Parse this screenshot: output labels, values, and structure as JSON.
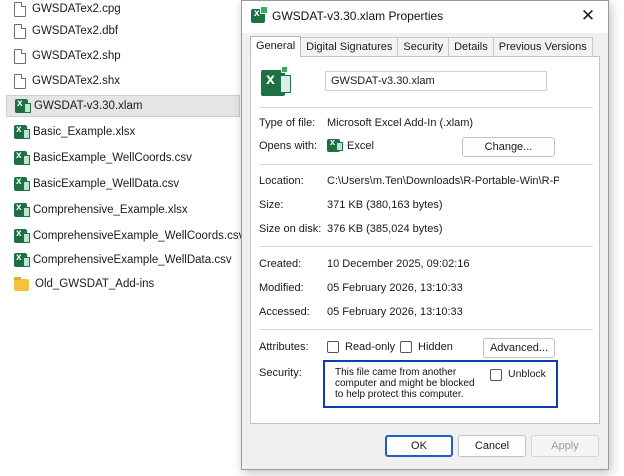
{
  "explorer": {
    "files": [
      {
        "name": "GWSDATex2.cpg",
        "icon": "document-icon",
        "selected": false
      },
      {
        "name": "GWSDATex2.dbf",
        "icon": "document-icon",
        "selected": false
      },
      {
        "name": "GWSDATex2.shp",
        "icon": "document-icon",
        "selected": false
      },
      {
        "name": "GWSDATex2.shx",
        "icon": "document-icon",
        "selected": false
      },
      {
        "name": "GWSDAT-v3.30.xlam",
        "icon": "excel-addin-icon",
        "selected": true
      },
      {
        "name": "Basic_Example.xlsx",
        "icon": "excel-file-icon",
        "selected": false
      },
      {
        "name": "BasicExample_WellCoords.csv",
        "icon": "excel-file-icon",
        "selected": false
      },
      {
        "name": "BasicExample_WellData.csv",
        "icon": "excel-file-icon",
        "selected": false
      },
      {
        "name": "Comprehensive_Example.xlsx",
        "icon": "excel-file-icon",
        "selected": false
      },
      {
        "name": "ComprehensiveExample_WellCoords.csv",
        "icon": "excel-file-icon",
        "selected": false
      },
      {
        "name": "ComprehensiveExample_WellData.csv",
        "icon": "excel-file-icon",
        "selected": false
      },
      {
        "name": "Old_GWSDAT_Add-ins",
        "icon": "folder-icon",
        "selected": false
      }
    ]
  },
  "dialog": {
    "title": "GWSDAT-v3.30.xlam Properties",
    "close_glyph": "✕",
    "tabs": [
      {
        "label": "General",
        "active": true
      },
      {
        "label": "Digital Signatures",
        "active": false
      },
      {
        "label": "Security",
        "active": false
      },
      {
        "label": "Details",
        "active": false
      },
      {
        "label": "Previous Versions",
        "active": false
      }
    ],
    "file_name": "GWSDAT-v3.30.xlam",
    "type_label": "Type of file:",
    "type_value": "Microsoft Excel Add-In (.xlam)",
    "opens_label": "Opens with:",
    "opens_value": "Excel",
    "change_button": "Change...",
    "location_label": "Location:",
    "location_value": "C:\\Users\\m.Ten\\Downloads\\R-Portable-Win\\R-Port",
    "size_label": "Size:",
    "size_value": "371 KB (380,163 bytes)",
    "size_disk_label": "Size on disk:",
    "size_disk_value": "376 KB (385,024 bytes)",
    "created_label": "Created:",
    "created_value": "10 December 2025, 09:02:16",
    "modified_label": "Modified:",
    "modified_value": "05 February 2026, 13:10:33",
    "accessed_label": "Accessed:",
    "accessed_value": "05 February 2026, 13:10:33",
    "attributes_label": "Attributes:",
    "readonly_label": "Read-only",
    "hidden_label": "Hidden",
    "advanced_button": "Advanced...",
    "security_label": "Security:",
    "security_text": "This file came from another computer and might be blocked to help protect this computer.",
    "unblock_label": "Unblock",
    "ok_button": "OK",
    "cancel_button": "Cancel",
    "apply_button": "Apply",
    "highlight_color": "#0b3fb0",
    "accent_color": "#1f5fbf"
  }
}
